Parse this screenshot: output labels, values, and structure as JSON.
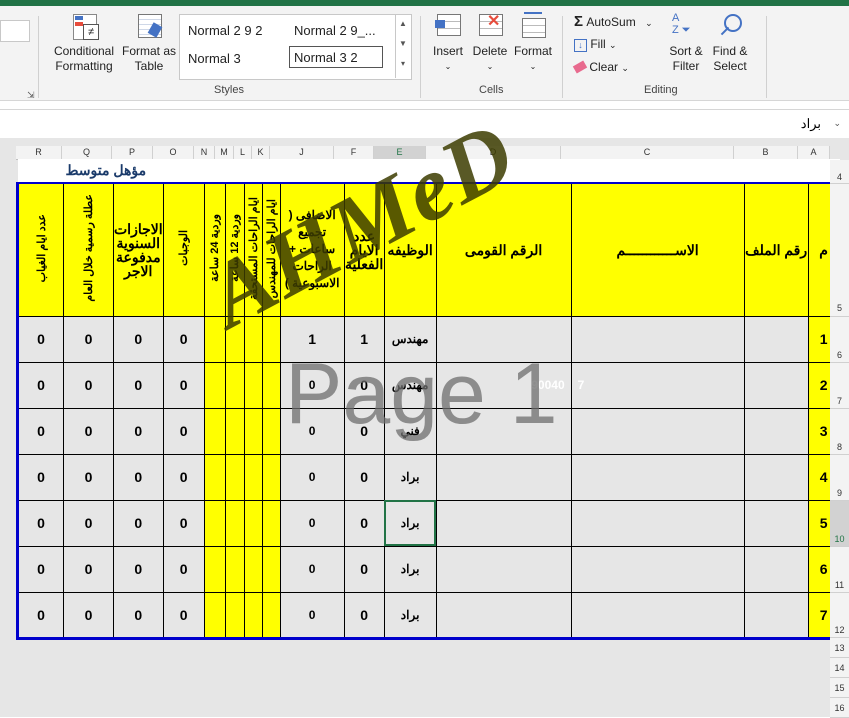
{
  "ribbon": {
    "styles_group": {
      "conditional_formatting": "Conditional Formatting",
      "format_as_table": "Format as Table",
      "style_items": [
        "Normal 2 9 2",
        "Normal 2 9_...",
        "Normal 3",
        "Normal 3 2"
      ],
      "label": "Styles"
    },
    "cells_group": {
      "insert": "Insert",
      "delete": "Delete",
      "format": "Format",
      "label": "Cells"
    },
    "editing_group": {
      "autosum": "AutoSum",
      "fill": "Fill",
      "clear": "Clear",
      "sort_filter": "Sort & Filter",
      "find_select": "Find & Select",
      "label": "Editing"
    }
  },
  "formula_bar": {
    "value": "براد"
  },
  "columns": [
    "R",
    "Q",
    "P",
    "O",
    "N",
    "M",
    "L",
    "K",
    "J",
    "F",
    "E",
    "D",
    "C",
    "B",
    "A"
  ],
  "selected_column": "E",
  "rows": [
    "4",
    "5",
    "6",
    "7",
    "8",
    "9",
    "10",
    "11",
    "12",
    "13",
    "14",
    "15",
    "16"
  ],
  "selected_row": "10",
  "sheet": {
    "title": "مؤهل متوسط",
    "headers": {
      "m": "م",
      "file_no": "رقم الملف",
      "name": "الاســــــــــــم",
      "national_id": "الرقم القومى",
      "job": "الوظيفه",
      "actual_days": "عدد الايام الفعلية",
      "extra": "الاضافى ( تجميع ساعات + الراحات الاسبوعية )",
      "engineer_rest": "ايام الراحات للمهندس",
      "due_rest": "ايام الراحات المستحقة",
      "shift12": "وردية 12 ساعة",
      "shift24": "وردية 24 ساعة",
      "meals": "الوجبات",
      "annual_leave": "الاجازات السنوية مدفوعة الاجر",
      "official_holiday": "عطلة رسمية خلال العام",
      "absence_days": "عدد ايام الغياب"
    },
    "data_rows": [
      {
        "m": "1",
        "job": "مهندس",
        "actual": "1",
        "extra": "1",
        "meals": "0",
        "annual": "0",
        "holiday": "0",
        "absence": "0"
      },
      {
        "m": "2",
        "job": "مهندس",
        "actual": "0",
        "extra": "0",
        "meals": "0",
        "annual": "0",
        "holiday": "0",
        "absence": "0"
      },
      {
        "m": "3",
        "job": "فني",
        "actual": "0",
        "extra": "0",
        "meals": "0",
        "annual": "0",
        "holiday": "0",
        "absence": "0"
      },
      {
        "m": "4",
        "job": "براد",
        "actual": "0",
        "extra": "0",
        "meals": "0",
        "annual": "0",
        "holiday": "0",
        "absence": "0"
      },
      {
        "m": "5",
        "job": "براد",
        "actual": "0",
        "extra": "0",
        "meals": "0",
        "annual": "0",
        "holiday": "0",
        "absence": "0"
      },
      {
        "m": "6",
        "job": "براد",
        "actual": "0",
        "extra": "0",
        "meals": "0",
        "annual": "0",
        "holiday": "0",
        "absence": "0"
      },
      {
        "m": "7",
        "job": "براد",
        "actual": "0",
        "extra": "0",
        "meals": "0",
        "annual": "0",
        "holiday": "0",
        "absence": "0"
      }
    ],
    "partial_id": "90040",
    "partial_id_end": "7"
  },
  "watermarks": {
    "page": "Page 1",
    "text": "AHMeD"
  },
  "colors": {
    "header_yellow": "#ffff00",
    "border_blue": "#0000cc",
    "excel_green": "#217346"
  }
}
